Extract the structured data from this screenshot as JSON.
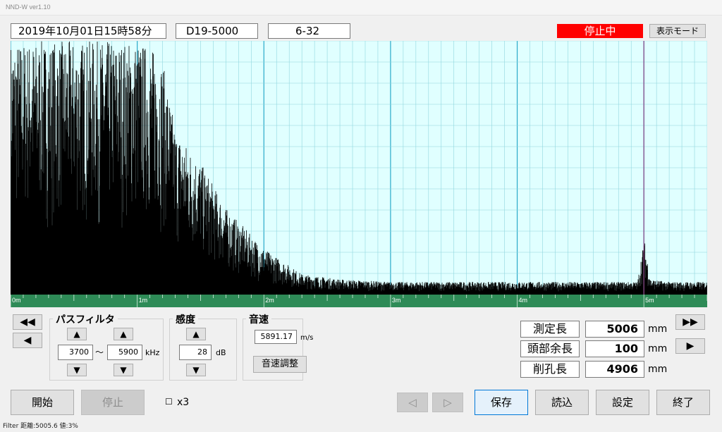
{
  "window": {
    "title": "NND-W ver1.10"
  },
  "header": {
    "datetime": "2019年10月01日15時58分",
    "bar_id": "D19-5000",
    "position_id": "6-32",
    "status": "停止中",
    "display_mode_button": "表示モード"
  },
  "chart_data": {
    "type": "line",
    "title": "",
    "xlabel": "",
    "ylabel": "",
    "xlim": [
      0,
      5.5
    ],
    "x_unit": "m",
    "ylim": [
      0,
      100
    ],
    "grid": true,
    "tick_labels": [
      "0m",
      "1m",
      "2m",
      "3m",
      "4m",
      "5m"
    ],
    "series": [
      {
        "color": "#000000",
        "x": [
          0.0,
          0.2,
          0.4,
          0.6,
          0.8,
          1.0,
          1.1,
          1.2,
          1.3,
          1.5,
          1.7,
          2.0,
          2.3,
          2.6,
          3.0,
          3.5,
          4.0,
          4.5,
          4.95,
          5.0,
          5.05,
          5.2,
          5.5
        ],
        "y": [
          100,
          100,
          100,
          100,
          100,
          100,
          98,
          92,
          65,
          52,
          34,
          18,
          8,
          6,
          5,
          5,
          5,
          5,
          5,
          22,
          6,
          5,
          5
        ]
      }
    ],
    "marker": {
      "x": 5.0,
      "color": "#8b4c8b"
    }
  },
  "transport": {
    "rewind_fast": "◀◀",
    "rewind": "◀",
    "forward_fast": "▶▶",
    "forward": "▶"
  },
  "bandpass": {
    "title": "パスフィルタ",
    "low": "3700",
    "tilde": "～",
    "high": "5900",
    "unit": "kHz",
    "up": "▲",
    "down": "▼"
  },
  "sensitivity": {
    "title": "感度",
    "value": "28",
    "unit": "dB",
    "up": "▲",
    "down": "▼"
  },
  "sound_speed": {
    "title": "音速",
    "value": "5891.17",
    "unit": "m/s",
    "adjust_button": "音速調整"
  },
  "measurements": [
    {
      "label": "測定長",
      "value": "5006",
      "unit": "mm"
    },
    {
      "label": "頭部余長",
      "value": "100",
      "unit": "mm"
    },
    {
      "label": "削孔長",
      "value": "4906",
      "unit": "mm"
    }
  ],
  "bottom": {
    "start": "開始",
    "stop": "停止",
    "x3_checkbox": "☐",
    "x3_label": "x3",
    "prev": "◁",
    "next": "▷",
    "save": "保存",
    "load": "読込",
    "settings": "設定",
    "exit": "終了"
  },
  "footer": {
    "status": "Filter 距離:5005.6 値:3%"
  }
}
